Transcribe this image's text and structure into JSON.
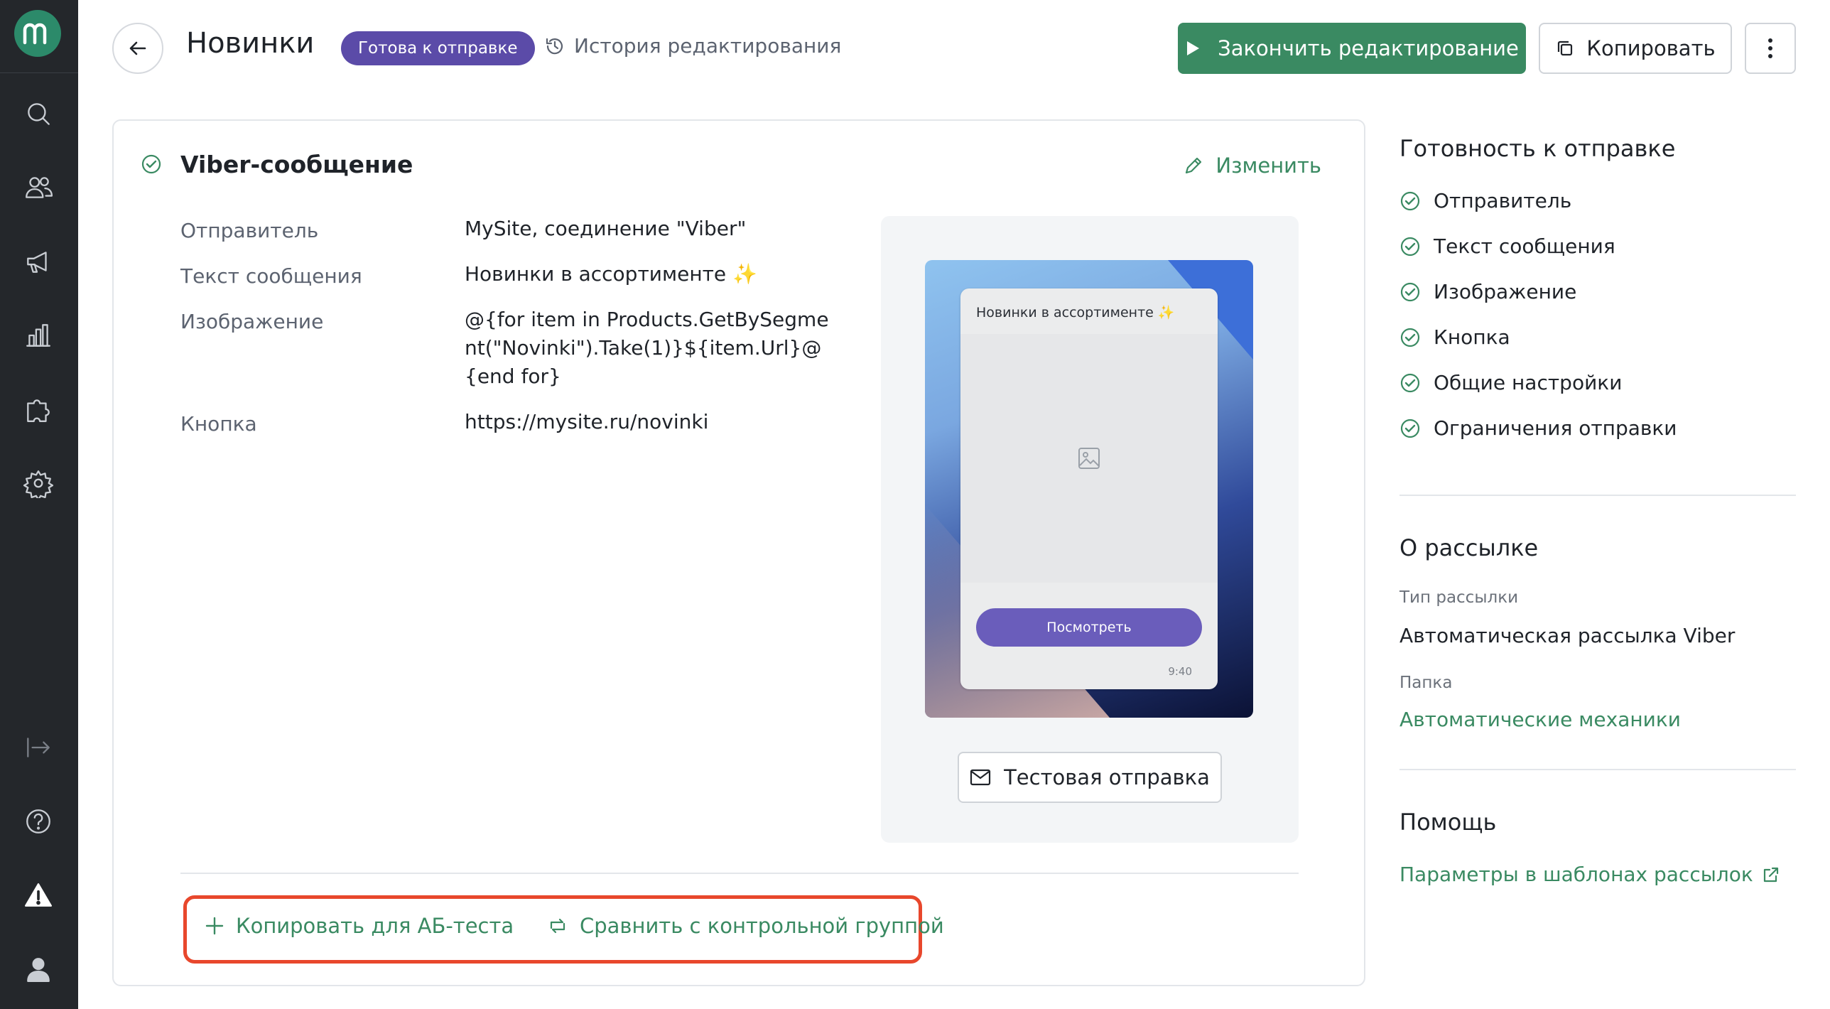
{
  "app": {
    "logo_letter": "m"
  },
  "header": {
    "title": "Новинки",
    "status_badge": "Готова к отправке",
    "history_label": "История редактирования",
    "finish_label": "Закончить редактирование",
    "copy_label": "Копировать"
  },
  "card": {
    "title": "Viber-сообщение",
    "edit_label": "Изменить",
    "fields": [
      {
        "label": "Отправитель",
        "value": "MySite, соединение \"Viber\""
      },
      {
        "label": "Текст сообщения",
        "value": "Новинки в ассортименте ✨"
      },
      {
        "label": "Изображение",
        "value": "@{for item in Products.GetBySegment(\"Novinki\").Take(1)}${item.Url}@{end for}"
      },
      {
        "label": "Кнопка",
        "value": "https://mysite.ru/novinki"
      }
    ],
    "preview": {
      "message_text": "Новинки в ассортименте ✨",
      "button_label": "Посмотреть",
      "time": "9:40"
    },
    "test_send_label": "Тестовая отправка",
    "ab_test_label": "Копировать для АБ-теста",
    "control_group_label": "Сравнить с контрольной группой"
  },
  "readiness": {
    "heading": "Готовность к отправке",
    "items": [
      "Отправитель",
      "Текст сообщения",
      "Изображение",
      "Кнопка",
      "Общие настройки",
      "Ограничения отправки"
    ]
  },
  "about": {
    "heading": "О рассылке",
    "type_label": "Тип рассылки",
    "type_value": "Автоматическая рассылка Viber",
    "folder_label": "Папка",
    "folder_value": "Автоматические механики"
  },
  "help": {
    "heading": "Помощь",
    "link_label": "Параметры в шаблонах рассылок"
  },
  "colors": {
    "sidebar_bg": "#24272b",
    "accent_green": "#3a8a62",
    "badge_purple": "#5b4ba8",
    "highlight_red": "#e8472c"
  }
}
